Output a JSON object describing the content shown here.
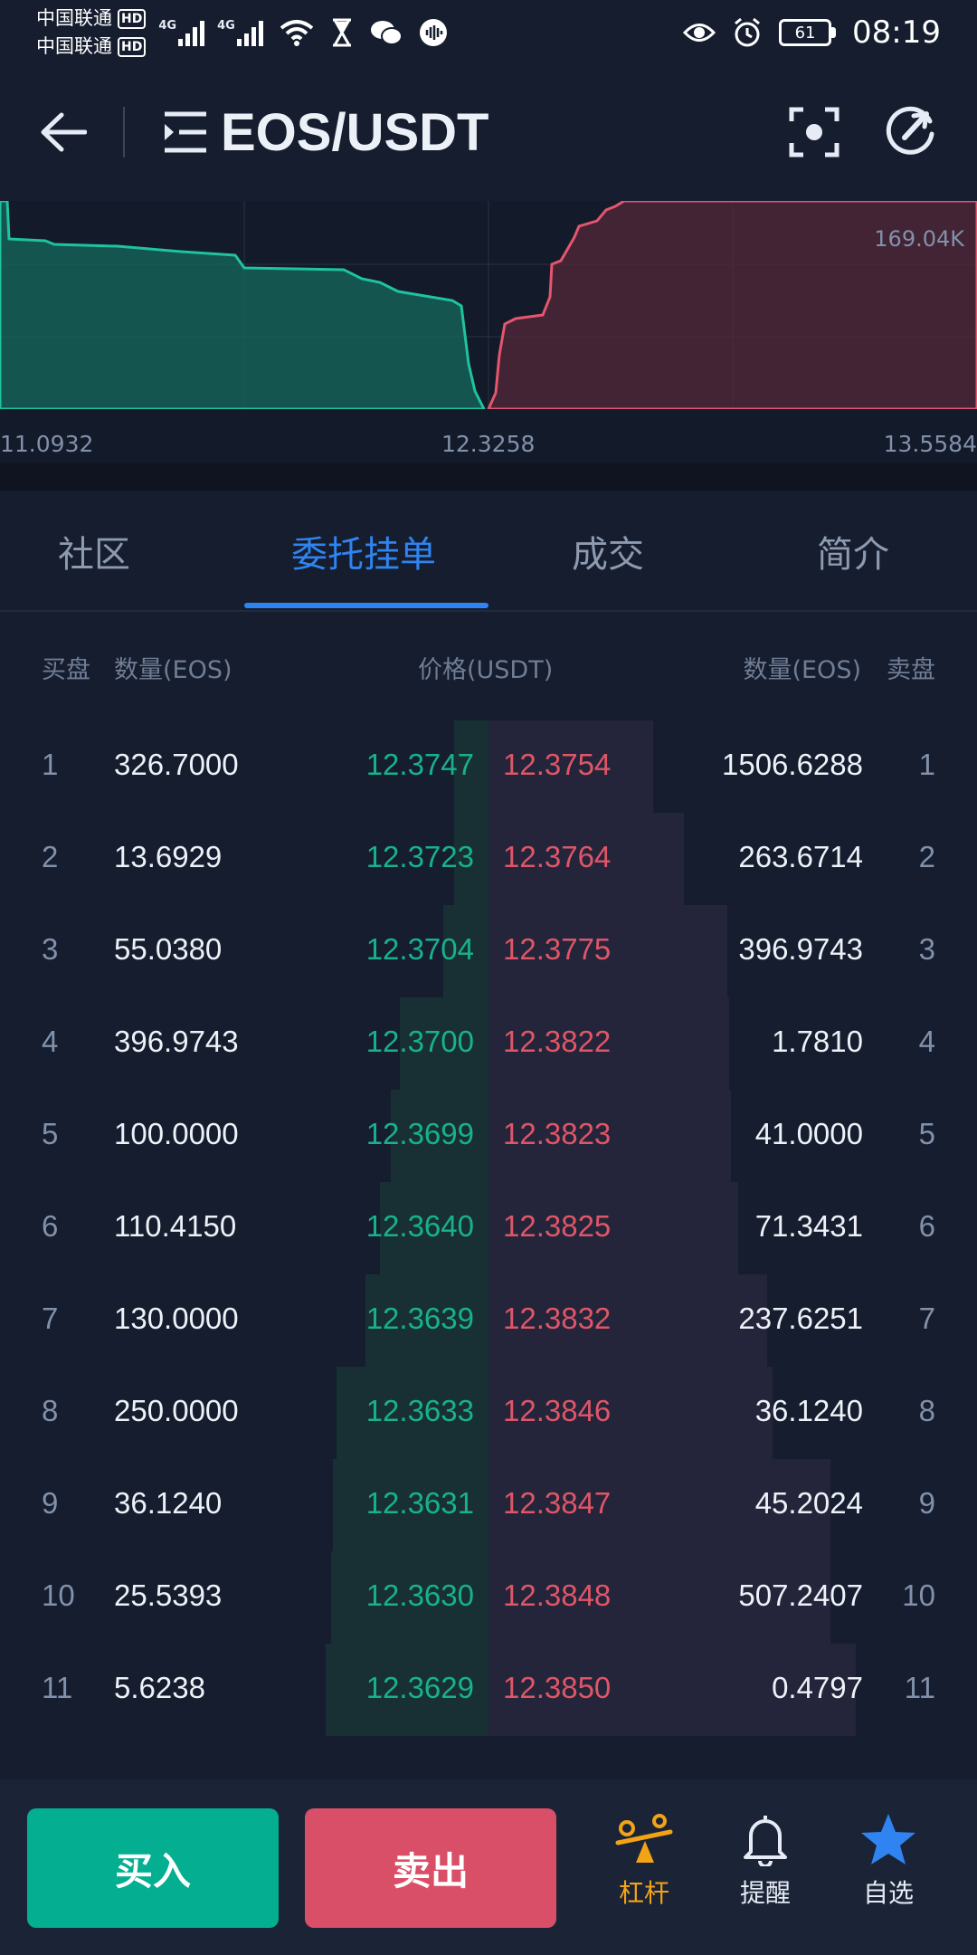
{
  "status_bar": {
    "carrier1": "中国联通",
    "carrier2": "中国联通",
    "hd": "HD",
    "net1": "4G",
    "net2": "4G",
    "battery": "61",
    "time": "08:19"
  },
  "header": {
    "pair": "EOS/USDT"
  },
  "depth_chart": {
    "y_label": "169.04K",
    "x_labels": [
      "11.0932",
      "12.3258",
      "13.5584"
    ],
    "colors": {
      "bid": "#1ec3a0",
      "ask": "#e5566e"
    }
  },
  "tabs": [
    {
      "label": "社区",
      "active": false
    },
    {
      "label": "委托挂单",
      "active": true
    },
    {
      "label": "成交",
      "active": false
    },
    {
      "label": "简介",
      "active": false
    }
  ],
  "order_book": {
    "headers": {
      "buy": "买盘",
      "buy_qty": "数量(EOS)",
      "price": "价格(USDT)",
      "sell_qty": "数量(EOS)",
      "sell": "卖盘"
    },
    "rows": [
      {
        "idx": "1",
        "bid_qty": "326.7000",
        "bid_price": "12.3747",
        "ask_price": "12.3754",
        "ask_qty": "1506.6288"
      },
      {
        "idx": "2",
        "bid_qty": "13.6929",
        "bid_price": "12.3723",
        "ask_price": "12.3764",
        "ask_qty": "263.6714"
      },
      {
        "idx": "3",
        "bid_qty": "55.0380",
        "bid_price": "12.3704",
        "ask_price": "12.3775",
        "ask_qty": "396.9743"
      },
      {
        "idx": "4",
        "bid_qty": "396.9743",
        "bid_price": "12.3700",
        "ask_price": "12.3822",
        "ask_qty": "1.7810"
      },
      {
        "idx": "5",
        "bid_qty": "100.0000",
        "bid_price": "12.3699",
        "ask_price": "12.3823",
        "ask_qty": "41.0000"
      },
      {
        "idx": "6",
        "bid_qty": "110.4150",
        "bid_price": "12.3640",
        "ask_price": "12.3825",
        "ask_qty": "71.3431"
      },
      {
        "idx": "7",
        "bid_qty": "130.0000",
        "bid_price": "12.3639",
        "ask_price": "12.3832",
        "ask_qty": "237.6251"
      },
      {
        "idx": "8",
        "bid_qty": "250.0000",
        "bid_price": "12.3633",
        "ask_price": "12.3846",
        "ask_qty": "36.1240"
      },
      {
        "idx": "9",
        "bid_qty": "36.1240",
        "bid_price": "12.3631",
        "ask_price": "12.3847",
        "ask_qty": "45.2024"
      },
      {
        "idx": "10",
        "bid_qty": "25.5393",
        "bid_price": "12.3630",
        "ask_price": "12.3848",
        "ask_qty": "507.2407"
      },
      {
        "idx": "11",
        "bid_qty": "5.6238",
        "bid_price": "12.3629",
        "ask_price": "12.3850",
        "ask_qty": "0.4797"
      }
    ]
  },
  "bottom_bar": {
    "buy_label": "买入",
    "sell_label": "卖出",
    "nav": [
      {
        "label": "杠杆",
        "icon": "leverage-icon",
        "active": true
      },
      {
        "label": "提醒",
        "icon": "bell-icon",
        "active": false
      },
      {
        "label": "自选",
        "icon": "star-icon",
        "active": false
      }
    ]
  },
  "colors": {
    "background": "#151d2e",
    "accent": "#2f84f1",
    "bid": "#17b28c",
    "ask": "#de5668",
    "buy_button": "#04ae90",
    "sell_button": "#d84f67",
    "active_nav": "#f3a316"
  }
}
